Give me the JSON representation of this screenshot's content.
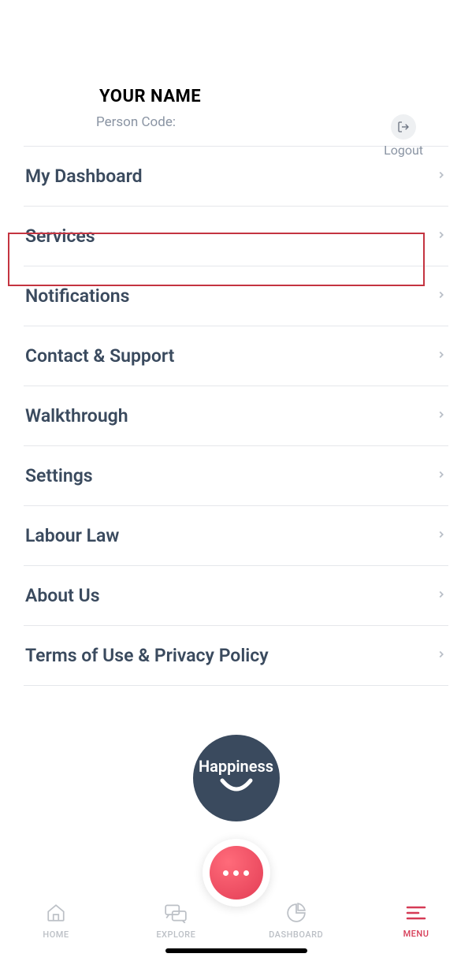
{
  "header": {
    "user_name": "YOUR NAME",
    "person_code_label": "Person Code:",
    "logout_label": "Logout"
  },
  "menu": {
    "items": [
      {
        "label": "My Dashboard"
      },
      {
        "label": "Services"
      },
      {
        "label": "Notifications"
      },
      {
        "label": "Contact & Support"
      },
      {
        "label": "Walkthrough"
      },
      {
        "label": "Settings"
      },
      {
        "label": "Labour Law"
      },
      {
        "label": "About Us"
      },
      {
        "label": "Terms of Use & Privacy Policy"
      }
    ]
  },
  "happiness": {
    "label": "Happiness"
  },
  "nav": {
    "home": "HOME",
    "explore": "EXPLORE",
    "dashboard": "DASHBOARD",
    "menu": "MENU"
  },
  "colors": {
    "accent": "#d63b56",
    "text_primary": "#3a4a5e",
    "text_muted": "#8a94a3",
    "highlight_border": "#c43440"
  }
}
